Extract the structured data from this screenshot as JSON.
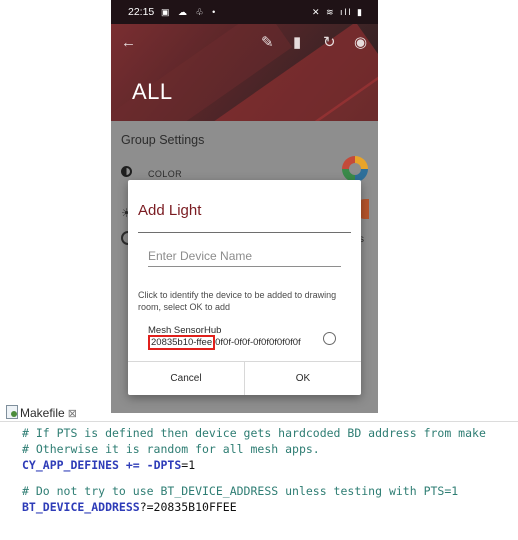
{
  "status_bar": {
    "time": "22:15",
    "left_icons": "▣ ☁ ♧ •",
    "right_icons": "✕ ≋ ıll ▮"
  },
  "app_bar": {
    "title": "ALL",
    "icons": [
      "back-arrow",
      "edit",
      "delete",
      "refresh",
      "target"
    ]
  },
  "background": {
    "section_title": "Group Settings",
    "color_label": "COLOR",
    "s_fragment": "s"
  },
  "dialog": {
    "title": "Add Light",
    "input_placeholder": "Enter Device Name",
    "hint": "Click to identify the device to be added to drawing room, select OK to add",
    "device": {
      "name": "Mesh SensorHub",
      "uuid_highlight": "20835b10-ffee",
      "uuid_rest": "0f0f-0f0f-0f0f0f0f0f0f"
    },
    "cancel_label": "Cancel",
    "ok_label": "OK"
  },
  "editor": {
    "tab_label": "Makefile",
    "tab_close": "⊠",
    "lines": {
      "l1": "# If PTS is defined then device gets hardcoded BD address from make",
      "l2": "# Otherwise it is random for all mesh apps.",
      "l3_key": "CY_APP_DEFINES",
      "l3_op": " += ",
      "l3_val1": "-DPTS",
      "l3_val2": "=1",
      "l4": "# Do not try to use BT_DEVICE_ADDRESS unless testing with PTS=1",
      "l5_key": "BT_DEVICE_ADDRESS",
      "l5_val": "?=20835B10FFEE"
    }
  },
  "colors": {
    "accent": "#7a1b21",
    "highlight_box": "#e0201c",
    "comment": "#2e7d73",
    "keyword": "#2e3cb8"
  }
}
